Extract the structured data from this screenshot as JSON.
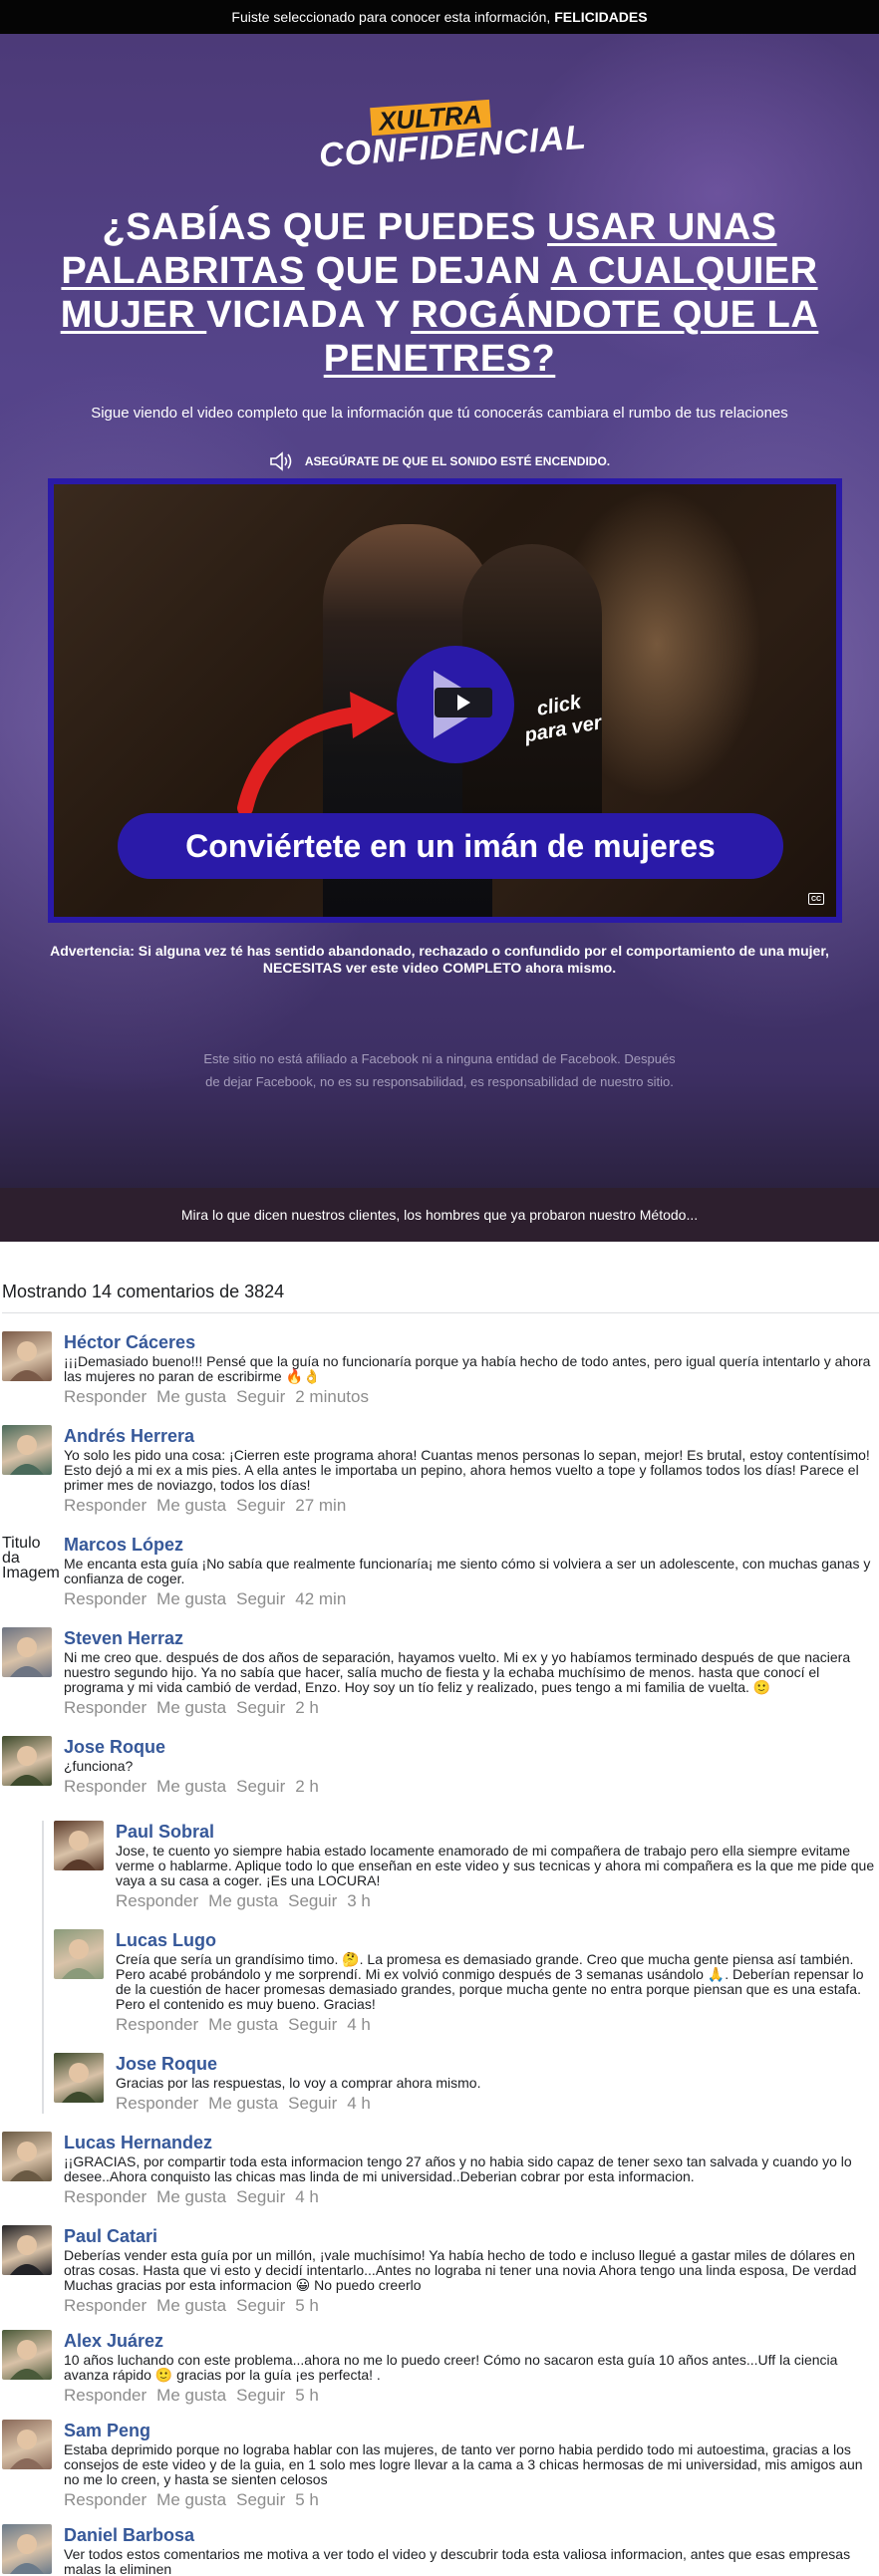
{
  "topbar": {
    "text": "Fuiste seleccionado para conocer esta información,",
    "bold": "FELICIDADES"
  },
  "logo": {
    "top": "XULTRA",
    "bottom": "CONFIDENCIAL"
  },
  "headline": {
    "p1": "¿SABÍAS QUE PUEDES ",
    "u1": "USAR UNAS PALABRITAS",
    "p2": " QUE DEJAN ",
    "u2": "A CUALQUIER MUJER ",
    "p3": "VICIADA Y ",
    "u3": "ROGÁNDOTE QUE LA PENETRES?"
  },
  "subline": "Sigue viendo el video completo que la información que tú conocerás cambiara el rumbo de tus relaciones",
  "sound_notice": "ASEGÚRATE DE QUE EL SONIDO ESTÉ ENCENDIDO.",
  "video": {
    "click_line1": "click",
    "click_line2": "para ver",
    "banner": "Conviértete en un imán de mujeres",
    "cc": "CC"
  },
  "warning": "Advertencia: Si alguna vez té has sentido abandonado, rechazado o confundido por el comportamiento de una mujer, NECESITAS ver este video COMPLETO ahora mismo.",
  "disclaimer": "Este sitio no está afiliado a Facebook ni a ninguna entidad de Facebook. Después de dejar Facebook, no es su responsabilidad, es responsabilidad de nuestro sitio.",
  "band": "Mira lo que dicen nuestros clientes, los hombres que ya probaron nuestro Método...",
  "comments_header": "Mostrando 14 comentarios de 3824",
  "actions": {
    "reply": "Responder",
    "like": "Me gusta",
    "follow": "Seguir"
  },
  "broken_avatar_alt": "Titulo da Imagem",
  "comments": [
    {
      "name": "Héctor Cáceres",
      "text": "¡¡¡Demasiado bueno!!! Pensé que la guía no funcionaría porque ya había hecho de todo antes, pero igual quería intentarlo y ahora las mujeres no paran de escribirme 🔥👌",
      "time": "2 minutos"
    },
    {
      "name": "Andrés Herrera",
      "text": "Yo solo les pido una cosa: ¡Cierren este programa ahora! Cuantas menos personas lo sepan, mejor! Es brutal, estoy contentísimo! Esto dejó a mi ex a mis pies. A ella antes le importaba un pepino, ahora hemos vuelto a tope y follamos todos los días! Parece el primer mes de noviazgo, todos los días!",
      "time": "27 min"
    },
    {
      "name": "Marcos López",
      "text": "Me encanta esta guía ¡No sabía que realmente funcionaría¡ me siento cómo si volviera a ser un adolescente, con muchas ganas y confianza de coger.",
      "time": "42 min"
    },
    {
      "name": "Steven Herraz",
      "text": "Ni me creo que. después de dos años de separación, hayamos vuelto. Mi ex y yo habíamos terminado después de que naciera nuestro segundo hijo. Ya no sabía que hacer, salía mucho de fiesta y la echaba muchísimo de menos. hasta que conocí el programa y mi vida cambió de verdad, Enzo. Hoy soy un tío feliz y realizado, pues tengo a mi familia de vuelta. 🙂",
      "time": "2 h"
    },
    {
      "name": "Jose Roque",
      "text": "¿funciona?",
      "time": "2 h"
    },
    {
      "name": "Paul Sobral",
      "text": "Jose, te cuento yo siempre habia estado locamente enamorado de mi compañera de trabajo pero ella siempre evitame verme o hablarme. Aplique todo lo que enseñan en este video y sus tecnicas y ahora mi compañera es la que me pide que vaya a su casa a coger. ¡Es una LOCURA!",
      "time": "3 h"
    },
    {
      "name": "Lucas Lugo",
      "text": "Creía que sería un grandísimo timo. 🤔. La promesa es demasiado grande. Creo que mucha gente piensa así también. Pero acabé probándolo y me sorprendí. Mi ex volvió conmigo después de 3 semanas usándolo 🙏. Deberían repensar lo de la cuestión de hacer promesas demasiado grandes, porque mucha gente no entra porque piensan que es una estafa. Pero el contenido es muy bueno. Gracias!",
      "time": "4 h"
    },
    {
      "name": "Jose Roque",
      "text": "Gracias por las respuestas, lo voy a comprar ahora mismo.",
      "time": "4 h"
    },
    {
      "name": "Lucas Hernandez",
      "text": "¡¡GRACIAS, por compartir toda esta informacion tengo 27 años y no habia sido capaz de tener sexo tan salvada y cuando yo lo desee..Ahora conquisto las chicas mas linda de mi universidad..Deberian cobrar por esta informacion.",
      "time": "4 h"
    },
    {
      "name": "Paul Catari",
      "text": "Deberías vender esta guía por un millón, ¡vale muchísimo! Ya había hecho de todo e incluso llegué a gastar miles de dólares en otras cosas. Hasta que vi esto y decidí intentarlo...Antes no lograba ni tener una novia Ahora tengo una linda esposa, De verdad Muchas gracias por esta informacion 😀 No puedo creerlo",
      "time": "5 h"
    },
    {
      "name": "Alex Juárez",
      "text": "10 años luchando con este problema...ahora no me lo puedo creer! Cómo no sacaron esta guía 10 años antes...Uff la ciencia avanza rápido 🙂 gracias por la guía ¡es perfecta! .",
      "time": "5 h"
    },
    {
      "name": "Sam Peng",
      "text": "Estaba deprimido porque no lograba hablar con las mujeres, de tanto ver porno habia perdido todo mi autoestima, gracias a los consejos de este video y de la guia, en 1 solo mes logre llevar a la cama a 3 chicas hermosas de mi universidad, mis amigos aun no me lo creen, y hasta se sienten celosos",
      "time": "5 h"
    },
    {
      "name": "Daniel Barbosa",
      "text": "Ver todos estos comentarios me motiva a ver todo el video y descubrir toda esta valiosa informacion, antes que esas empresas malas la eliminen",
      "time": ""
    }
  ],
  "colors": {
    "name_link": "#365899",
    "video_accent": "#2a1aa8",
    "logo_accent": "#f5a623"
  }
}
